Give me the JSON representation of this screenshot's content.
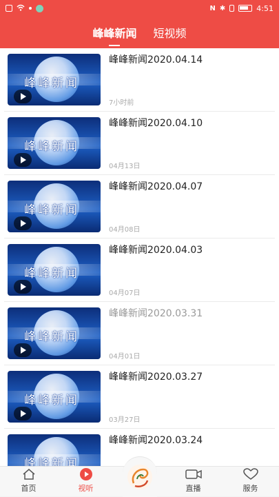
{
  "status": {
    "time": "4:51"
  },
  "header": {
    "tabs": [
      {
        "label": "峰峰新闻",
        "active": true
      },
      {
        "label": "短视频",
        "active": false
      }
    ]
  },
  "thumbnail_brand": "峰峰新闻",
  "videos": [
    {
      "title": "峰峰新闻2020.04.14",
      "date": "7小时前",
      "read": false
    },
    {
      "title": "峰峰新闻2020.04.10",
      "date": "04月13日",
      "read": false
    },
    {
      "title": "峰峰新闻2020.04.07",
      "date": "04月08日",
      "read": false
    },
    {
      "title": "峰峰新闻2020.04.03",
      "date": "04月07日",
      "read": false
    },
    {
      "title": "峰峰新闻2020.03.31",
      "date": "04月01日",
      "read": true
    },
    {
      "title": "峰峰新闻2020.03.27",
      "date": "03月27日",
      "read": false
    },
    {
      "title": "峰峰新闻2020.03.24",
      "date": "",
      "read": false
    }
  ],
  "bottom_nav": {
    "home": "首页",
    "listen": "视听",
    "live": "直播",
    "service": "服务"
  },
  "colors": {
    "accent": "#ee4c45"
  }
}
